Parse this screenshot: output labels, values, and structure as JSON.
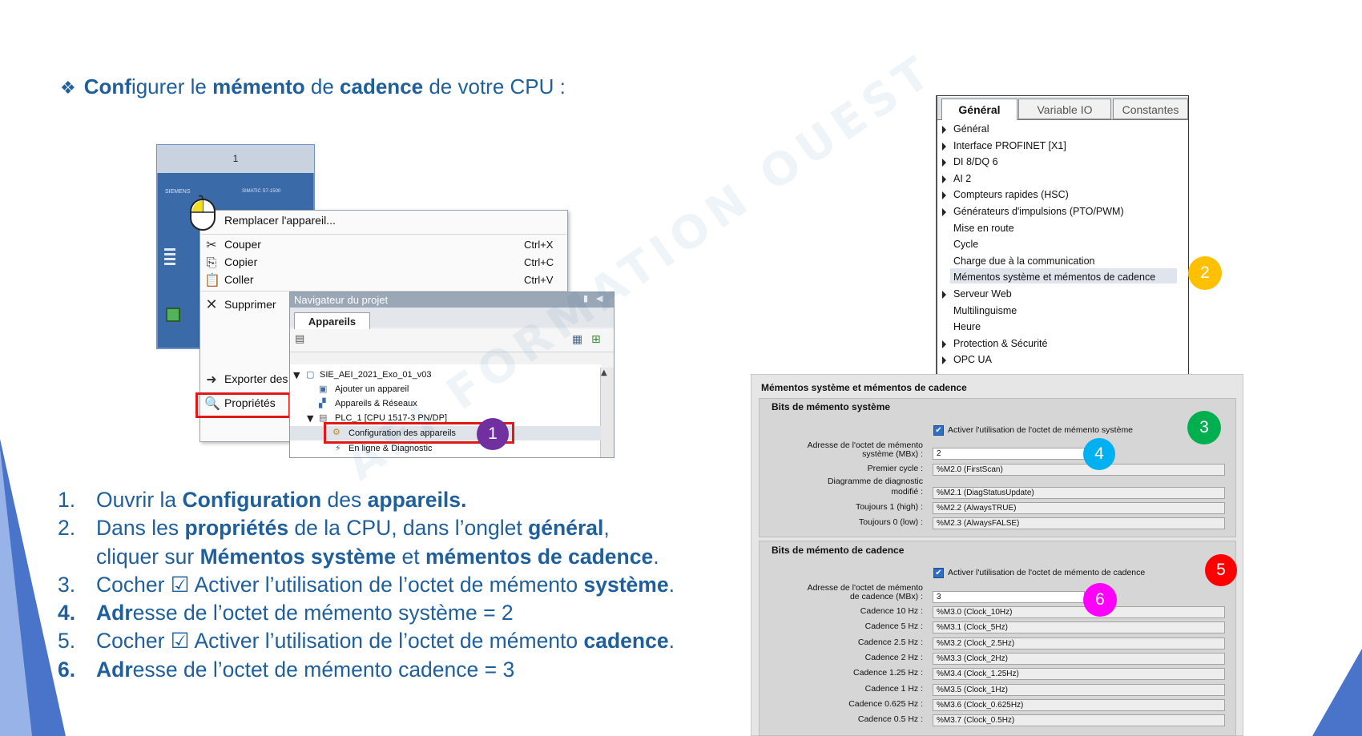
{
  "title": {
    "segments": [
      {
        "text": "Conf",
        "bold": true
      },
      {
        "text": "igurer le ",
        "bold": false
      },
      {
        "text": "mémento",
        "bold": true
      },
      {
        "text": " de ",
        "bold": false
      },
      {
        "text": "cadence",
        "bold": true
      },
      {
        "text": " de votre CPU :",
        "bold": false
      }
    ]
  },
  "steps": [
    {
      "num": "1.",
      "num_bold": false,
      "segments": [
        {
          "t": "Ouvrir la ",
          "b": false
        },
        {
          "t": "Configuration",
          "b": true
        },
        {
          "t": " des ",
          "b": false
        },
        {
          "t": "appareils.",
          "b": true
        }
      ]
    },
    {
      "num": "2.",
      "num_bold": false,
      "segments": [
        {
          "t": "Dans les ",
          "b": false
        },
        {
          "t": "propriétés",
          "b": true
        },
        {
          "t": " de la CPU, dans l’onglet ",
          "b": false
        },
        {
          "t": "général",
          "b": true
        },
        {
          "t": ",",
          "b": false
        }
      ]
    },
    {
      "num": "",
      "num_bold": false,
      "segments": [
        {
          "t": "cliquer sur ",
          "b": false
        },
        {
          "t": "Mémentos système",
          "b": true
        },
        {
          "t": " et ",
          "b": false
        },
        {
          "t": "mémentos de cadence",
          "b": true
        },
        {
          "t": ".",
          "b": false
        }
      ]
    },
    {
      "num": "3.",
      "num_bold": false,
      "segments": [
        {
          "t": "Cocher ☑ Activer l’utilisation de l’octet de mémento ",
          "b": false
        },
        {
          "t": "système",
          "b": true
        },
        {
          "t": ".",
          "b": false
        }
      ]
    },
    {
      "num": "4.",
      "num_bold": true,
      "segments": [
        {
          "t": "Adr",
          "b": true
        },
        {
          "t": "esse de l’octet de mémento système = 2",
          "b": false
        }
      ]
    },
    {
      "num": "5.",
      "num_bold": false,
      "segments": [
        {
          "t": "Cocher ☑ Activer l’utilisation de l’octet de mémento ",
          "b": false
        },
        {
          "t": "cadence",
          "b": true
        },
        {
          "t": ".",
          "b": false
        }
      ]
    },
    {
      "num": "6.",
      "num_bold": true,
      "segments": [
        {
          "t": "Adr",
          "b": true
        },
        {
          "t": "esse de l’octet de mémento cadence = 3",
          "b": false
        }
      ]
    }
  ],
  "watermark": "AEI FORMATION OUEST",
  "plc": {
    "slot": "1",
    "brand": "SIEMENS",
    "model": "SIMATIC S7-1500"
  },
  "context_menu": {
    "replace": "Remplacer l'appareil...",
    "cut": "Couper",
    "cut_key": "Ctrl+X",
    "copy": "Copier",
    "copy_key": "Ctrl+C",
    "paste": "Coller",
    "paste_key": "Ctrl+V",
    "delete": "Supprimer",
    "export": "Exporter des",
    "properties": "Propriétés"
  },
  "navigator": {
    "title": "Navigateur du projet",
    "tab": "Appareils",
    "tree": [
      "SIE_AEI_2021_Exo_01_v03",
      "Ajouter un appareil",
      "Appareils & Réseaux",
      "PLC_1 [CPU 1517-3 PN/DP]",
      "Configuration des appareils",
      "En ligne & Diagnostic"
    ]
  },
  "badges": {
    "b1": "1",
    "b2": "2",
    "b3": "3",
    "b4": "4",
    "b5": "5",
    "b6": "6",
    "colors": {
      "b1": "#7030a0",
      "b2": "#ffc000",
      "b3": "#00b050",
      "b4": "#00b0f0",
      "b5": "#ff0000",
      "b6": "#ff00ff"
    }
  },
  "properties": {
    "tabs": [
      "Général",
      "Variable IO",
      "Constantes"
    ],
    "items": [
      {
        "label": "Général",
        "arrow": true
      },
      {
        "label": "Interface PROFINET [X1]",
        "arrow": true
      },
      {
        "label": "DI 8/DQ 6",
        "arrow": true
      },
      {
        "label": "AI 2",
        "arrow": true
      },
      {
        "label": "Compteurs rapides (HSC)",
        "arrow": true
      },
      {
        "label": "Générateurs d'impulsions (PTO/PWM)",
        "arrow": true
      },
      {
        "label": "Mise en route",
        "arrow": false
      },
      {
        "label": "Cycle",
        "arrow": false
      },
      {
        "label": "Charge due à la communication",
        "arrow": false
      },
      {
        "label": "Mémentos système et mémentos de cadence",
        "arrow": false
      },
      {
        "label": "Serveur Web",
        "arrow": true
      },
      {
        "label": "Multilinguisme",
        "arrow": false
      },
      {
        "label": "Heure",
        "arrow": false
      },
      {
        "label": "Protection & Sécurité",
        "arrow": true
      },
      {
        "label": "OPC UA",
        "arrow": true
      }
    ]
  },
  "bits": {
    "title": "Mémentos système et mémentos de cadence",
    "system": {
      "section": "Bits de mémento système",
      "enable": "Activer l'utilisation de l'octet de mémento système",
      "addr_label_1": "Adresse de l'octet de mémento",
      "addr_label_2": "système (MBx) :",
      "addr_value": "2",
      "fields": [
        {
          "l1": "",
          "l2": "Premier cycle :",
          "v": "%M2.0 (FirstScan)"
        },
        {
          "l1": "Diagramme de diagnostic",
          "l2": "modifié :",
          "v": "%M2.1 (DiagStatusUpdate)"
        },
        {
          "l1": "",
          "l2": "Toujours 1 (high) :",
          "v": "%M2.2 (AlwaysTRUE)"
        },
        {
          "l1": "",
          "l2": "Toujours 0 (low) :",
          "v": "%M2.3 (AlwaysFALSE)"
        }
      ]
    },
    "clock": {
      "section": "Bits de mémento de cadence",
      "enable": "Activer l'utilisation de l'octet de mémento de cadence",
      "addr_label_1": "Adresse de l'octet de mémento",
      "addr_label_2": "de cadence (MBx) :",
      "addr_value": "3",
      "fields": [
        {
          "l": "Cadence  10 Hz :",
          "v": "%M3.0 (Clock_10Hz)"
        },
        {
          "l": "Cadence  5 Hz :",
          "v": "%M3.1 (Clock_5Hz)"
        },
        {
          "l": "Cadence  2.5 Hz :",
          "v": "%M3.2 (Clock_2.5Hz)"
        },
        {
          "l": "Cadence  2 Hz :",
          "v": "%M3.3 (Clock_2Hz)"
        },
        {
          "l": "Cadence  1.25 Hz :",
          "v": "%M3.4 (Clock_1.25Hz)"
        },
        {
          "l": "Cadence  1 Hz :",
          "v": "%M3.5 (Clock_1Hz)"
        },
        {
          "l": "Cadence  0.625 Hz :",
          "v": "%M3.6 (Clock_0.625Hz)"
        },
        {
          "l": "Cadence  0.5 Hz :",
          "v": "%M3.7 (Clock_0.5Hz)"
        }
      ]
    }
  }
}
